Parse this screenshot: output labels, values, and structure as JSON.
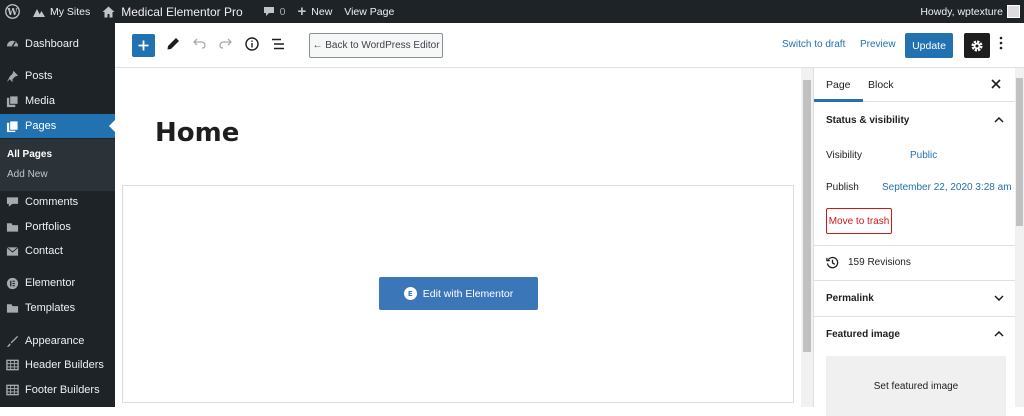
{
  "adminbar": {
    "my_sites": "My Sites",
    "site_name": "Medical Elementor Pro",
    "comments_count": "0",
    "new_label": "New",
    "view_page": "View Page",
    "howdy": "Howdy, wptexture"
  },
  "sidebar": {
    "items": [
      {
        "label": "Dashboard",
        "icon": "dashboard-icon"
      },
      {
        "label": "Posts",
        "icon": "pin-icon"
      },
      {
        "label": "Media",
        "icon": "media-icon"
      },
      {
        "label": "Pages",
        "icon": "pages-icon"
      },
      {
        "label": "Comments",
        "icon": "comment-icon"
      },
      {
        "label": "Portfolios",
        "icon": "folder-icon"
      },
      {
        "label": "Contact",
        "icon": "mail-icon"
      },
      {
        "label": "Elementor",
        "icon": "elementor-icon"
      },
      {
        "label": "Templates",
        "icon": "folder-icon"
      },
      {
        "label": "Appearance",
        "icon": "brush-icon"
      },
      {
        "label": "Header Builders",
        "icon": "grid-icon"
      },
      {
        "label": "Footer Builders",
        "icon": "grid-icon"
      }
    ],
    "submenu": {
      "all_pages": "All Pages",
      "add_new": "Add New"
    }
  },
  "header": {
    "back_label": "← Back to WordPress Editor",
    "switch_draft": "Switch to draft",
    "preview": "Preview",
    "update": "Update"
  },
  "canvas": {
    "title": "Home",
    "elementor_button": "Edit with Elementor",
    "elementor_badge": "E"
  },
  "settings": {
    "tabs": {
      "page": "Page",
      "block": "Block"
    },
    "status_title": "Status & visibility",
    "visibility_label": "Visibility",
    "visibility_value": "Public",
    "publish_label": "Publish",
    "publish_value": "September 22, 2020 3:28 am",
    "trash": "Move to trash",
    "revisions": "159 Revisions",
    "permalink": "Permalink",
    "featured_title": "Featured image",
    "set_featured": "Set featured image"
  },
  "colors": {
    "accent": "#2271b1",
    "admin_dark": "#1d2327",
    "elementor": "#3b76b9",
    "danger": "#cc1818"
  }
}
